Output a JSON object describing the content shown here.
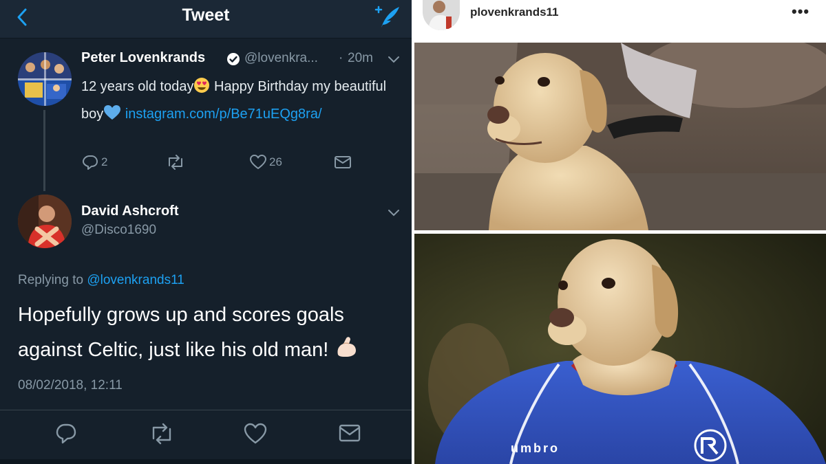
{
  "twitter": {
    "header": {
      "title": "Tweet",
      "back_icon": "chevron-left-icon",
      "compose_icon": "compose-tweet-icon"
    },
    "tweet1": {
      "name": "Peter Lovenkrands",
      "handle": "@lovenkra...",
      "time_separator": "·",
      "time": "20m",
      "text_part1": "12 years old today",
      "text_part2": " Happy Birthday my beautiful boy",
      "link": "instagram.com/p/Be71uEQg8ra/",
      "replies": "2",
      "likes": "26"
    },
    "tweet2": {
      "name": "David Ashcroft",
      "handle": "@Disco1690",
      "replying_prefix": "Replying to ",
      "replying_handle": "@lovenkrands11",
      "text": "Hopefully grows up and scores goals against Celtic, just like his old man! ",
      "datetime": "08/02/2018, 12:11"
    },
    "colors": {
      "background": "#15202b",
      "accent": "#1da1f2",
      "muted": "#8899a6"
    }
  },
  "instagram": {
    "username": "plovenkrands11",
    "more_icon": "more-options-icon"
  }
}
